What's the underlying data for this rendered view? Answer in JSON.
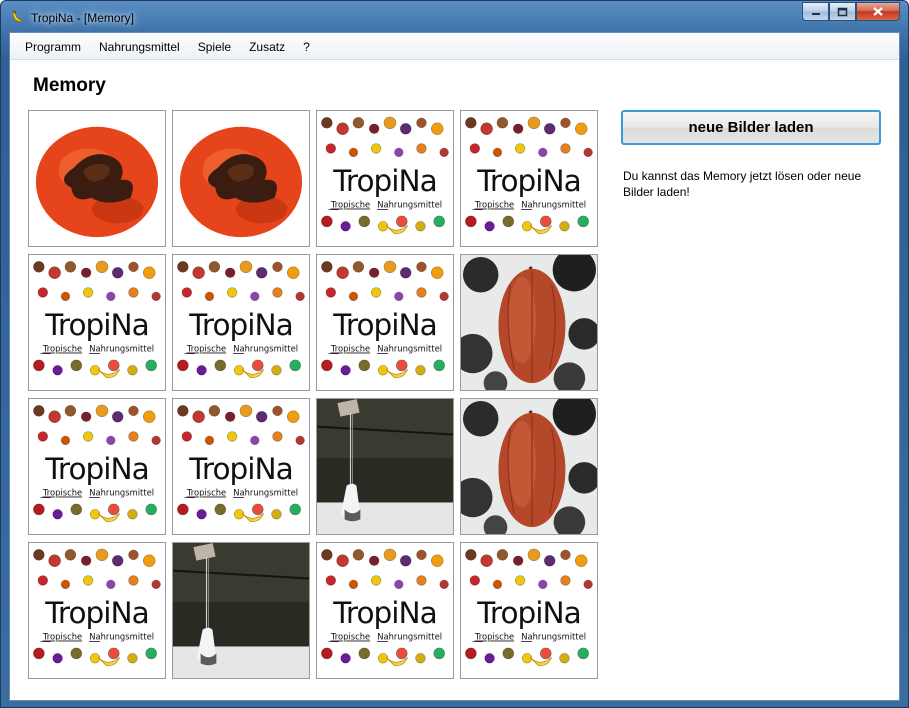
{
  "window": {
    "title": "TropiNa - [Memory]",
    "app_icon": "banana-icon"
  },
  "menu": [
    {
      "label": "Programm"
    },
    {
      "label": "Nahrungsmittel"
    },
    {
      "label": "Spiele"
    },
    {
      "label": "Zusatz"
    },
    {
      "label": "?"
    }
  ],
  "page": {
    "title": "Memory"
  },
  "logo": {
    "word": "TropiNa",
    "tagline_1": "Tropische",
    "tagline_2": "Nahrungsmittel"
  },
  "cards": [
    {
      "face": "persimmon"
    },
    {
      "face": "persimmon"
    },
    {
      "face": "logo"
    },
    {
      "face": "logo"
    },
    {
      "face": "logo"
    },
    {
      "face": "logo"
    },
    {
      "face": "logo"
    },
    {
      "face": "cacao-pod"
    },
    {
      "face": "logo"
    },
    {
      "face": "logo"
    },
    {
      "face": "hanging-fruit"
    },
    {
      "face": "cacao-pod"
    },
    {
      "face": "logo"
    },
    {
      "face": "hanging-fruit"
    },
    {
      "face": "logo"
    },
    {
      "face": "logo"
    }
  ],
  "sidebar": {
    "load_button": "neue Bilder laden",
    "info": "Du kannst das Memory jetzt lösen oder neue Bilder laden!"
  },
  "colors": {
    "accent_border": "#3c9bd6",
    "title_bar": "#3f74aa"
  }
}
